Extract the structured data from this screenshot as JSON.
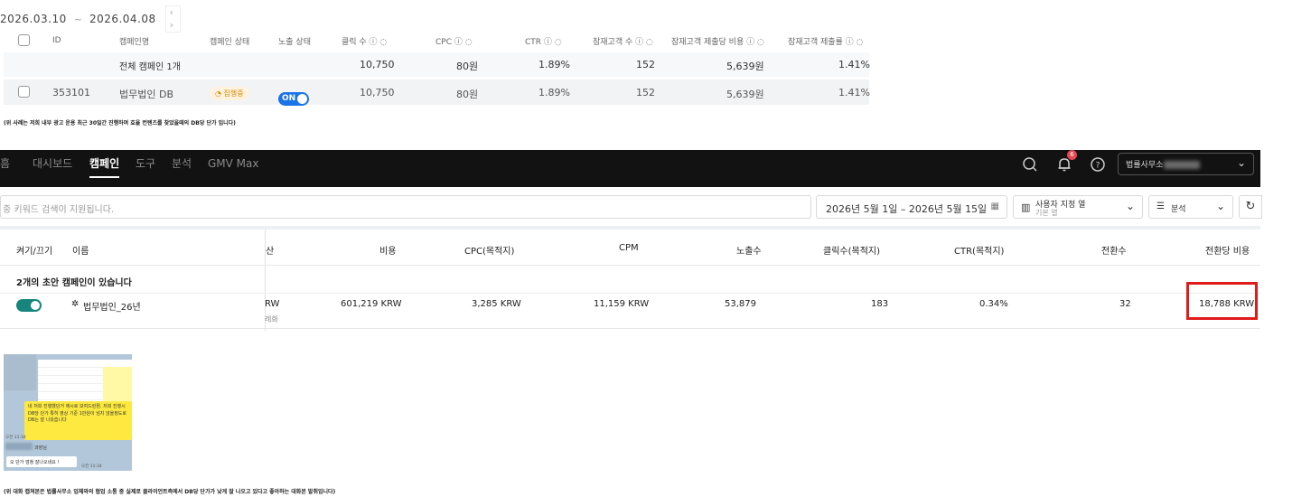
{
  "section1": {
    "date_start": "2026.03.10",
    "date_sep": "~",
    "date_end": "2026.04.08",
    "date_nav": "‹ ›",
    "headers": {
      "id": "ID",
      "campaign": "캠페인명",
      "campaign_status": "캠페인 상태",
      "exposure_status": "노출 상태",
      "clicks": "클릭 수 ⓘ ◌",
      "cpc": "CPC ⓘ ◌",
      "ctr": "CTR ⓘ ◌",
      "leads": "잠재고객 수 ⓘ ◌",
      "cost_per_lead": "잠재고객 제출당 비용 ⓘ ◌",
      "lead_rate": "잠재고객 제출률 ⓘ ◌"
    },
    "total_row": {
      "label": "전체 캠페인 1개",
      "clicks": "10,750",
      "cpc": "80원",
      "ctr": "1.89%",
      "leads": "152",
      "cost_per_lead": "5,639원",
      "lead_rate": "1.41%"
    },
    "item_row": {
      "id": "353101",
      "campaign": "법무법인 DB",
      "status": "◔ 집행중",
      "exposure": "ON",
      "clicks": "10,750",
      "cpc": "80원",
      "ctr": "1.89%",
      "leads": "152",
      "cost_per_lead": "5,639원",
      "lead_rate": "1.41%"
    },
    "note": "(위 사례는 저희 내부 광고 운용 최근 30일간 진행하며 효율 컨텐츠를 찾았을때의 DB당 단가 입니다)"
  },
  "section2": {
    "nav": {
      "logo_partial": "흠",
      "dashboard": "대시보드",
      "campaign": "캠페인",
      "tools": "도구",
      "analytics": "분석",
      "gmv": "GMV Max"
    },
    "notification_count": "6",
    "account_name": "법률사무소",
    "search_placeholder": "중 키워드 검색이 지원됩니다.",
    "date_range": "2026년 5월 1일  –  2026년 5월 15일",
    "column_select": {
      "title": "사용자 지정 열",
      "sub": "기본 열"
    },
    "analysis_label": "분석",
    "headers": {
      "onoff": "켜기/끄기",
      "name": "이름",
      "budget_partial": "산",
      "cost": "비용",
      "cpc": "CPC(목적지)",
      "cpm": "CPM",
      "impressions": "노출수",
      "clicks": "클릭수(목적지)",
      "ctr": "CTR(목적지)",
      "conversions": "전환수",
      "cost_per_conv": "전환당 비용"
    },
    "draft_text": "2개의 초안 캠페인이 있습니다",
    "row": {
      "name": "법무법인_26년",
      "budget_partial": "RW",
      "budget_sub": "례화",
      "cost": "601,219 KRW",
      "cpc": "3,285 KRW",
      "cpm": "11,159 KRW",
      "impressions": "53,879",
      "clicks": "183",
      "ctr": "0.34%",
      "conversions": "32",
      "cost_per_conv": "18,788 KRW"
    },
    "highlight_color": "#e01b1b"
  },
  "section3": {
    "bubble_text": "네 저희 진행했던거 에시로 보여드린뭔. 저희 진행시 DB당 단가 특히 영상 기준 1만원이 넘지 않을정도로 DB는 잘 나왔습니다",
    "bubble_time": "오전 11:34",
    "sender": "과장님",
    "reply": "오 단가 엄청 잘나오네요 !",
    "reply_time": "오전 11:34",
    "note": "(위 대화 캡쳐본은 법률사무소 업체와의 협업 소통 중 실제로 클라이언트측에서 DB당 단가가 낮게 잘 나오고 있다고 좋아하는 대화본 발취입니다)"
  }
}
